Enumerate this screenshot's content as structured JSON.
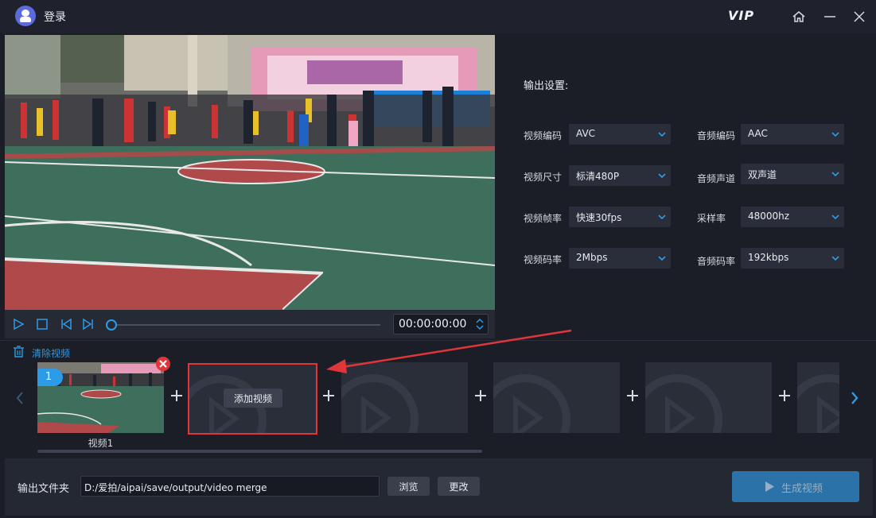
{
  "window": {
    "title": "登录",
    "vip_label": "VIP"
  },
  "icons": {
    "app": "app-logo-icon",
    "home": "home-icon",
    "minimize": "minimize-icon",
    "close": "close-icon",
    "play": "play-icon",
    "stop": "stop-icon",
    "prev": "skip-back-icon",
    "next": "skip-forward-icon",
    "trash": "trash-icon",
    "remove": "remove-clip-icon",
    "plus": "plus-icon"
  },
  "player": {
    "time": "00:00:00:00",
    "progress": 0
  },
  "settings": {
    "title": "输出设置:",
    "fields": [
      {
        "label": "视频编码",
        "value": "AVC"
      },
      {
        "label": "音频编码",
        "value": "AAC"
      },
      {
        "label": "视频尺寸",
        "value": "标清480P"
      },
      {
        "label": "音频声道",
        "value": "双声道"
      },
      {
        "label": "视频帧率",
        "value": "快速30fps"
      },
      {
        "label": "采样率",
        "value": "48000hz"
      },
      {
        "label": "视频码率",
        "value": "2Mbps"
      },
      {
        "label": "音频码率",
        "value": "192kbps"
      }
    ]
  },
  "timeline": {
    "clear_label": "清除视频",
    "clip": {
      "index": "1",
      "name": "视频1"
    },
    "add_label": "添加视频"
  },
  "output": {
    "label": "输出文件夹",
    "path": "D:/爱拍/aipai/save/output/video merge",
    "browse_label": "浏览",
    "change_label": "更改",
    "generate_label": "生成视频"
  },
  "colors": {
    "accent": "#2c9be8",
    "highlight": "#e0363a",
    "background": "#1b1e27"
  }
}
